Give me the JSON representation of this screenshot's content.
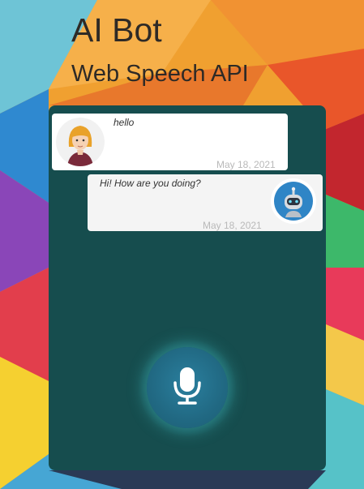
{
  "app": {
    "title": "AI Bot",
    "subtitle": "Web Speech API"
  },
  "messages": [
    {
      "sender": "user",
      "text": "hello",
      "date": "May 18, 2021",
      "avatar_icon": "user-avatar-icon"
    },
    {
      "sender": "bot",
      "text": "Hi! How are you doing?",
      "date": "May 18, 2021",
      "avatar_icon": "robot-avatar-icon"
    }
  ],
  "mic": {
    "icon": "microphone-icon"
  },
  "colors": {
    "panel": "#164d4e",
    "mic_button": "#216983",
    "user_bubble": "#ffffff",
    "bot_bubble": "#f4f4f4",
    "date_text": "#b9b9b9",
    "title_text": "#2e2a26"
  }
}
